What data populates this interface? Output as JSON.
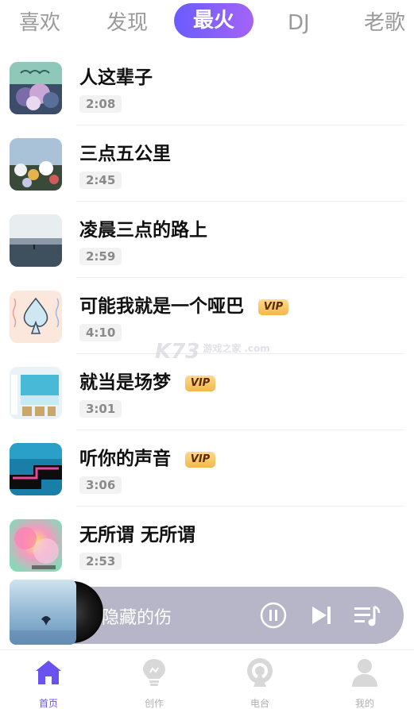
{
  "tabs": [
    {
      "label": "喜欢",
      "active": false
    },
    {
      "label": "发现",
      "active": false
    },
    {
      "label": "最火",
      "active": true
    },
    {
      "label": "DJ",
      "active": false
    },
    {
      "label": "老歌",
      "active": false
    }
  ],
  "songs": [
    {
      "title": "人这辈子",
      "duration": "2:08",
      "vip": false
    },
    {
      "title": "三点五公里",
      "duration": "2:45",
      "vip": false
    },
    {
      "title": "凌晨三点的路上",
      "duration": "2:59",
      "vip": false
    },
    {
      "title": "可能我就是一个哑巴",
      "duration": "4:10",
      "vip": true
    },
    {
      "title": "就当是场梦",
      "duration": "3:01",
      "vip": true
    },
    {
      "title": "听你的声音",
      "duration": "3:06",
      "vip": true
    },
    {
      "title": "无所谓 无所谓",
      "duration": "2:53",
      "vip": false
    }
  ],
  "vip_label": "VIP",
  "player": {
    "title": "隐藏的伤",
    "state": "playing"
  },
  "nav": [
    {
      "label": "首页",
      "icon": "home-icon",
      "active": true
    },
    {
      "label": "创作",
      "icon": "lightbulb-icon",
      "active": false
    },
    {
      "label": "电台",
      "icon": "radio-icon",
      "active": false
    },
    {
      "label": "我的",
      "icon": "user-icon",
      "active": false
    }
  ],
  "watermark": {
    "text": "K73",
    "sub": "游戏之家",
    "domain": ".com"
  },
  "colors": {
    "accent": "#6a52f0",
    "vip": "#f2b84b",
    "player_bg": "#b6b6c8"
  }
}
